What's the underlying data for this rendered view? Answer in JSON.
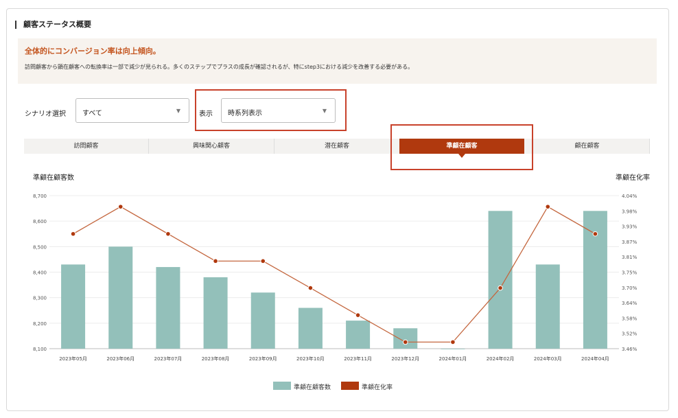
{
  "section": {
    "title": "顧客ステータス概要"
  },
  "summary": {
    "headline": "全体的にコンバージョン率は向上傾向。",
    "body": "訪問顧客から顕在顧客への転換率は一部で減少が見られる。多くのステップでプラスの成長が確認されるが、特にstep3における減少を改善する必要がある。"
  },
  "controls": {
    "scenario_label": "シナリオ選択",
    "scenario_value": "すべて",
    "display_label": "表示",
    "display_value": "時系列表示"
  },
  "tabs": [
    {
      "label": "訪問顧客"
    },
    {
      "label": "興味関心顧客"
    },
    {
      "label": "潜在顧客"
    },
    {
      "label": "準顧在顧客"
    },
    {
      "label": "顧在顧客"
    }
  ],
  "colors": {
    "bar": "#93c0ba",
    "line": "#c4673f",
    "accent": "#b0390e",
    "highlight": "#c8412a"
  },
  "chart_data": {
    "type": "bar",
    "left_axis_title": "準顧在顧客数",
    "right_axis_title": "準顧在化率",
    "categories": [
      "2023年05月",
      "2023年06月",
      "2023年07月",
      "2023年08月",
      "2023年09月",
      "2023年10月",
      "2023年11月",
      "2023年12月",
      "2024年01月",
      "2024年02月",
      "2024年03月",
      "2024年04月"
    ],
    "left_ticks": [
      "8,100",
      "8,200",
      "8,300",
      "8,400",
      "8,500",
      "8,600",
      "8,700"
    ],
    "right_ticks": [
      "3.46%",
      "3.52%",
      "3.58%",
      "3.64%",
      "3.70%",
      "3.75%",
      "3.81%",
      "3.87%",
      "3.93%",
      "3.98%",
      "4.04%"
    ],
    "ylim_left": [
      8100,
      8700
    ],
    "ylim_right": [
      3.46,
      4.04
    ],
    "series": [
      {
        "name": "準顧在顧客数",
        "type": "bar",
        "axis": "left",
        "values": [
          8430,
          8500,
          8420,
          8380,
          8320,
          8260,
          8210,
          8180,
          8100,
          8640,
          8430,
          8640
        ]
      },
      {
        "name": "準顧在化率",
        "type": "line",
        "axis": "right",
        "values": [
          3.895,
          3.998,
          3.895,
          3.792,
          3.792,
          3.69,
          3.587,
          3.485,
          3.485,
          3.69,
          3.998,
          3.895
        ]
      }
    ],
    "legend_position": "bottom"
  }
}
